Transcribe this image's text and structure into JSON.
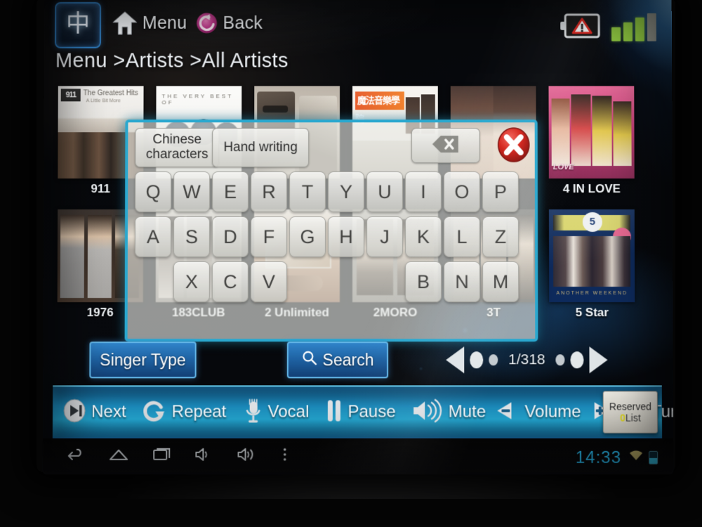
{
  "topbar": {
    "language_button": "中",
    "menu_label": "Menu",
    "back_label": "Back",
    "menu_icon": "home-icon",
    "back_icon": "back-arrow-icon",
    "battery_warning_icon": "battery-warning-icon",
    "signal_icon": "signal-bars-icon",
    "signal_bars_filled": 3,
    "signal_bars_total": 4
  },
  "breadcrumb": "Menu >Artists >All Artists",
  "grid": {
    "artists": [
      {
        "name": "911",
        "art": "art-911"
      },
      {
        "name": "",
        "art": "art-verybest"
      },
      {
        "name": "",
        "art": "art-sunglass"
      },
      {
        "name": "",
        "art": "art-magic"
      },
      {
        "name": "",
        "art": "art-twogirls"
      },
      {
        "name": "4 IN LOVE",
        "art": "art-4inlove"
      },
      {
        "name": "1976",
        "art": "art-1976"
      },
      {
        "name": "183CLUB",
        "art": "art-183"
      },
      {
        "name": "2 Unlimited",
        "art": "art-2unl"
      },
      {
        "name": "2MORO",
        "art": "art-2moro"
      },
      {
        "name": "3T",
        "art": "art-3t"
      },
      {
        "name": "5 Star",
        "art": "art-5star"
      }
    ],
    "art_text": {
      "a911_hdr": "911",
      "a911_t1": "The Greatest Hits",
      "a911_t2": "A Little Bit More",
      "verybest_t1": "THE VERY BEST OF",
      "magic_band": "魔法音樂學院",
      "inlove_logo": "LOVE",
      "star_circle": "5",
      "star_base": "ANOTHER WEEKEND"
    }
  },
  "keyboard": {
    "mode_chinese": "Chinese characters",
    "mode_handwriting": "Hand writing",
    "backspace_icon": "backspace-icon",
    "close_icon": "close-icon",
    "rows": [
      [
        "Q",
        "W",
        "E",
        "R",
        "T",
        "Y",
        "U",
        "I",
        "O",
        "P"
      ],
      [
        "A",
        "S",
        "D",
        "F",
        "G",
        "H",
        "J",
        "K",
        "L",
        "Z"
      ],
      [
        "X",
        "C",
        "V",
        "B",
        "N",
        "M"
      ]
    ],
    "row3_layout": [
      1,
      2,
      3,
      7,
      8,
      9
    ],
    "border_color": "#2aa8cf"
  },
  "actions": {
    "singer_type": "Singer Type",
    "search": "Search",
    "search_icon": "search-icon",
    "pager": {
      "label": "1/318",
      "current_page": 1,
      "total_pages": 318,
      "prev_icon": "prev-page-icon",
      "next_icon": "next-page-icon"
    }
  },
  "controlbar": {
    "items": [
      {
        "label": "Next",
        "icon": "next-track-icon"
      },
      {
        "label": "Repeat",
        "icon": "repeat-icon"
      },
      {
        "label": "Vocal",
        "icon": "microphone-icon"
      },
      {
        "label": "Pause",
        "icon": "pause-icon"
      },
      {
        "label": "Mute",
        "icon": "mute-speaker-icon"
      },
      {
        "label": "Volume",
        "icon": "volume-icon"
      },
      {
        "label": "Tuning",
        "icon": "tuning-sliders-icon"
      }
    ],
    "volume_minus_icon": "volume-down-icon",
    "volume_plus_icon": "volume-up-icon",
    "reserved": {
      "title": "Reserved",
      "count": "0",
      "list_word": "List"
    }
  },
  "navbar": {
    "back_icon": "android-back-icon",
    "home_icon": "android-home-icon",
    "recents_icon": "android-recents-icon",
    "vol_down_icon": "android-volume-down-icon",
    "vol_up_icon": "android-volume-up-icon",
    "overflow_icon": "android-overflow-icon",
    "clock": "14:33",
    "wifi_icon": "wifi-icon",
    "battery_icon": "battery-icon"
  },
  "colors": {
    "accent_cyan": "#2aa8cf",
    "bar_blue": "#23a3cc",
    "button_blue": "#2f83c9",
    "clock_blue": "#27a9d8",
    "reserved_count_yellow": "#d9d11f",
    "signal_green": "#8dc63f"
  }
}
